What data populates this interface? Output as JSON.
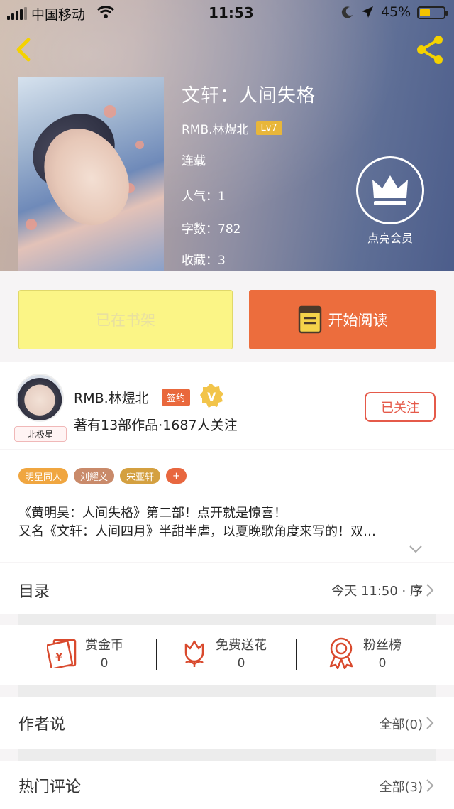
{
  "status_bar": {
    "carrier": "中国移动",
    "time": "11:53",
    "battery": "45%",
    "battery_level": 0.45
  },
  "book": {
    "title": "文轩：人间失格",
    "author": "RMB.林煜北",
    "level": "Lv7",
    "status": "连载",
    "popularity": "人气：1",
    "word_count": "字数：782",
    "favorites": "收藏：3"
  },
  "vip": {
    "label": "点亮会员"
  },
  "actions": {
    "shelf_label": "已在书架",
    "read_label": "开始阅读"
  },
  "author_card": {
    "name": "RMB.林煜北",
    "sign_label": "签约",
    "stats": "著有13部作品·1687人关注",
    "avatar_tag": "北极星",
    "follow_label": "已关注"
  },
  "tags": [
    {
      "label": "明星同人",
      "color": "#f0a640"
    },
    {
      "label": "刘耀文",
      "color": "#c98a6a"
    },
    {
      "label": "宋亚轩",
      "color": "#d4a040"
    },
    {
      "label": "+",
      "color": "#e8673f"
    }
  ],
  "intro": {
    "line1": "《黄明昊：人间失格》第二部！点开就是惊喜！",
    "line2": "又名《文轩：人间四月》半甜半虐，以夏晚歌角度来写的！双…"
  },
  "catalog": {
    "title": "目录",
    "update": "今天 11:50 · 序"
  },
  "stats": [
    {
      "label": "赏金币",
      "value": "0"
    },
    {
      "label": "免费送花",
      "value": "0"
    },
    {
      "label": "粉丝榜",
      "value": "0"
    }
  ],
  "author_says": {
    "title": "作者说",
    "count": "全部(0)"
  },
  "hot_comments": {
    "title": "热门评论",
    "count": "全部(3)"
  },
  "colors": {
    "accent": "#ec6d3d",
    "shelf": "#fbf586",
    "follow": "#e55a4a"
  }
}
